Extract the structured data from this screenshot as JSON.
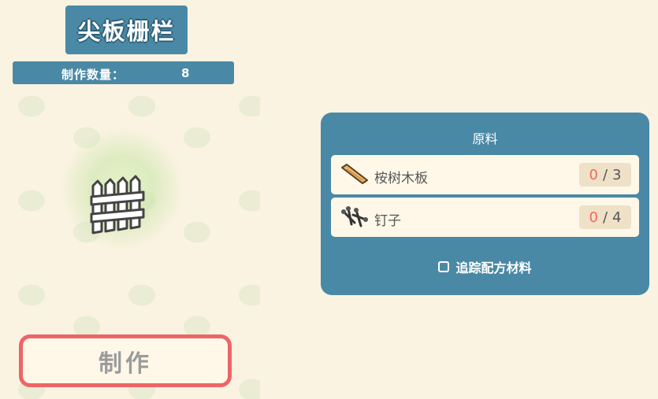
{
  "item": {
    "title": "尖板栅栏",
    "quantity_label": "制作数量：",
    "quantity_value": "8",
    "icon": "picket-fence-icon"
  },
  "craft_button": {
    "label": "制作"
  },
  "materials_panel": {
    "title": "原料",
    "items": [
      {
        "name": "桉树木板",
        "have": "0",
        "separator": "/",
        "need": "3",
        "icon": "plank-icon"
      },
      {
        "name": "钉子",
        "have": "0",
        "separator": "/",
        "need": "4",
        "icon": "nails-icon"
      }
    ],
    "track_label": "追踪配方材料",
    "track_checked": false
  },
  "colors": {
    "panel_blue": "#4a89a5",
    "background": "#fbf3e2",
    "button_border": "#ef6466",
    "missing_count": "#ef6a5e"
  }
}
